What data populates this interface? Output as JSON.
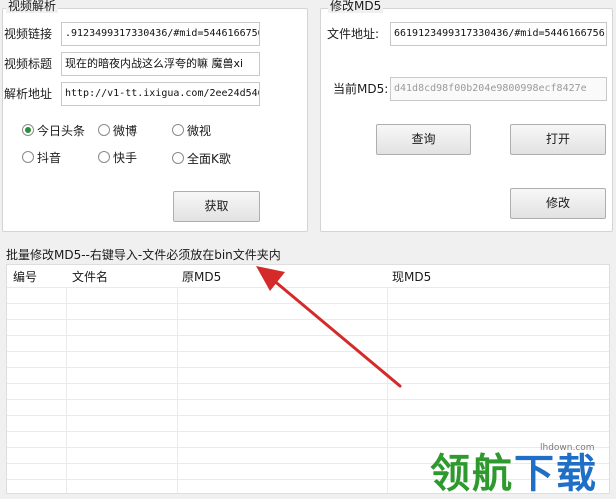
{
  "video_parse": {
    "title": "视频解析",
    "link_label": "视频链接",
    "link_value": ".9123499317330436/#mid=5446166756",
    "title_label": "视频标题",
    "title_value": "现在的暗夜内战这么浮夸的嘛 魔兽xi",
    "parse_label": "解析地址",
    "parse_value": "http://v1-tt.ixigua.com/2ee24d546",
    "radios": [
      {
        "label": "今日头条",
        "checked": true
      },
      {
        "label": "微博",
        "checked": false
      },
      {
        "label": "微视",
        "checked": false
      },
      {
        "label": "抖音",
        "checked": false
      },
      {
        "label": "快手",
        "checked": false
      },
      {
        "label": "全面K歌",
        "checked": false
      }
    ],
    "get_button": "获取"
  },
  "modify_md5": {
    "title": "修改MD5",
    "file_label": "文件地址:",
    "file_value": "6619123499317330436/#mid=5446166756",
    "md5_label": "当前MD5:",
    "md5_value": "d41d8cd98f00b204e9800998ecf8427e",
    "query_button": "查询",
    "open_button": "打开",
    "modify_button": "修改"
  },
  "batch": {
    "title": "批量修改MD5--右键导入-文件必须放在bin文件夹内",
    "columns": [
      "编号",
      "文件名",
      "原MD5",
      "现MD5"
    ]
  },
  "watermark": {
    "site": "lhdown.com",
    "text_main": "领航",
    "text_accent": "下载"
  },
  "colors": {
    "arrow": "#d42a2a",
    "watermark_green": "#2e9a2e",
    "watermark_blue": "#1f6fc6"
  }
}
